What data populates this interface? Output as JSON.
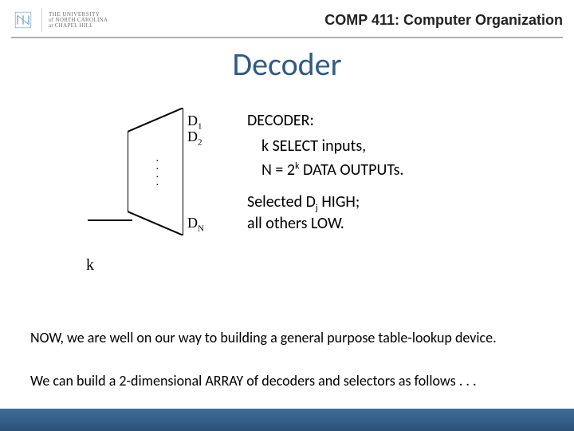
{
  "header": {
    "university_line1": "THE UNIVERSITY",
    "university_line2": "of NORTH CAROLINA",
    "university_line3": "at CHAPEL HILL",
    "course": "COMP 411: Computer Organization"
  },
  "title": "Decoder",
  "diagram": {
    "outputs": {
      "d1": "D",
      "d1_sub": "1",
      "d2": "D",
      "d2_sub": "2",
      "dN": "D",
      "dN_sub": "N"
    },
    "k_label": "k"
  },
  "desc": {
    "heading": "DECODER:",
    "line_inputs": "k SELECT inputs,",
    "line_outputs_pre": "N = 2",
    "line_outputs_sup": "k",
    "line_outputs_post": " DATA OUTPUTs.",
    "selected_pre": "Selected D",
    "selected_sub": "j",
    "selected_post": " HIGH;",
    "others": "all others LOW."
  },
  "body": {
    "p1": "NOW, we are well on our way to building a general purpose table-lookup device.",
    "p2": "We can build a 2-dimensional ARRAY of decoders and selectors as follows . . ."
  }
}
